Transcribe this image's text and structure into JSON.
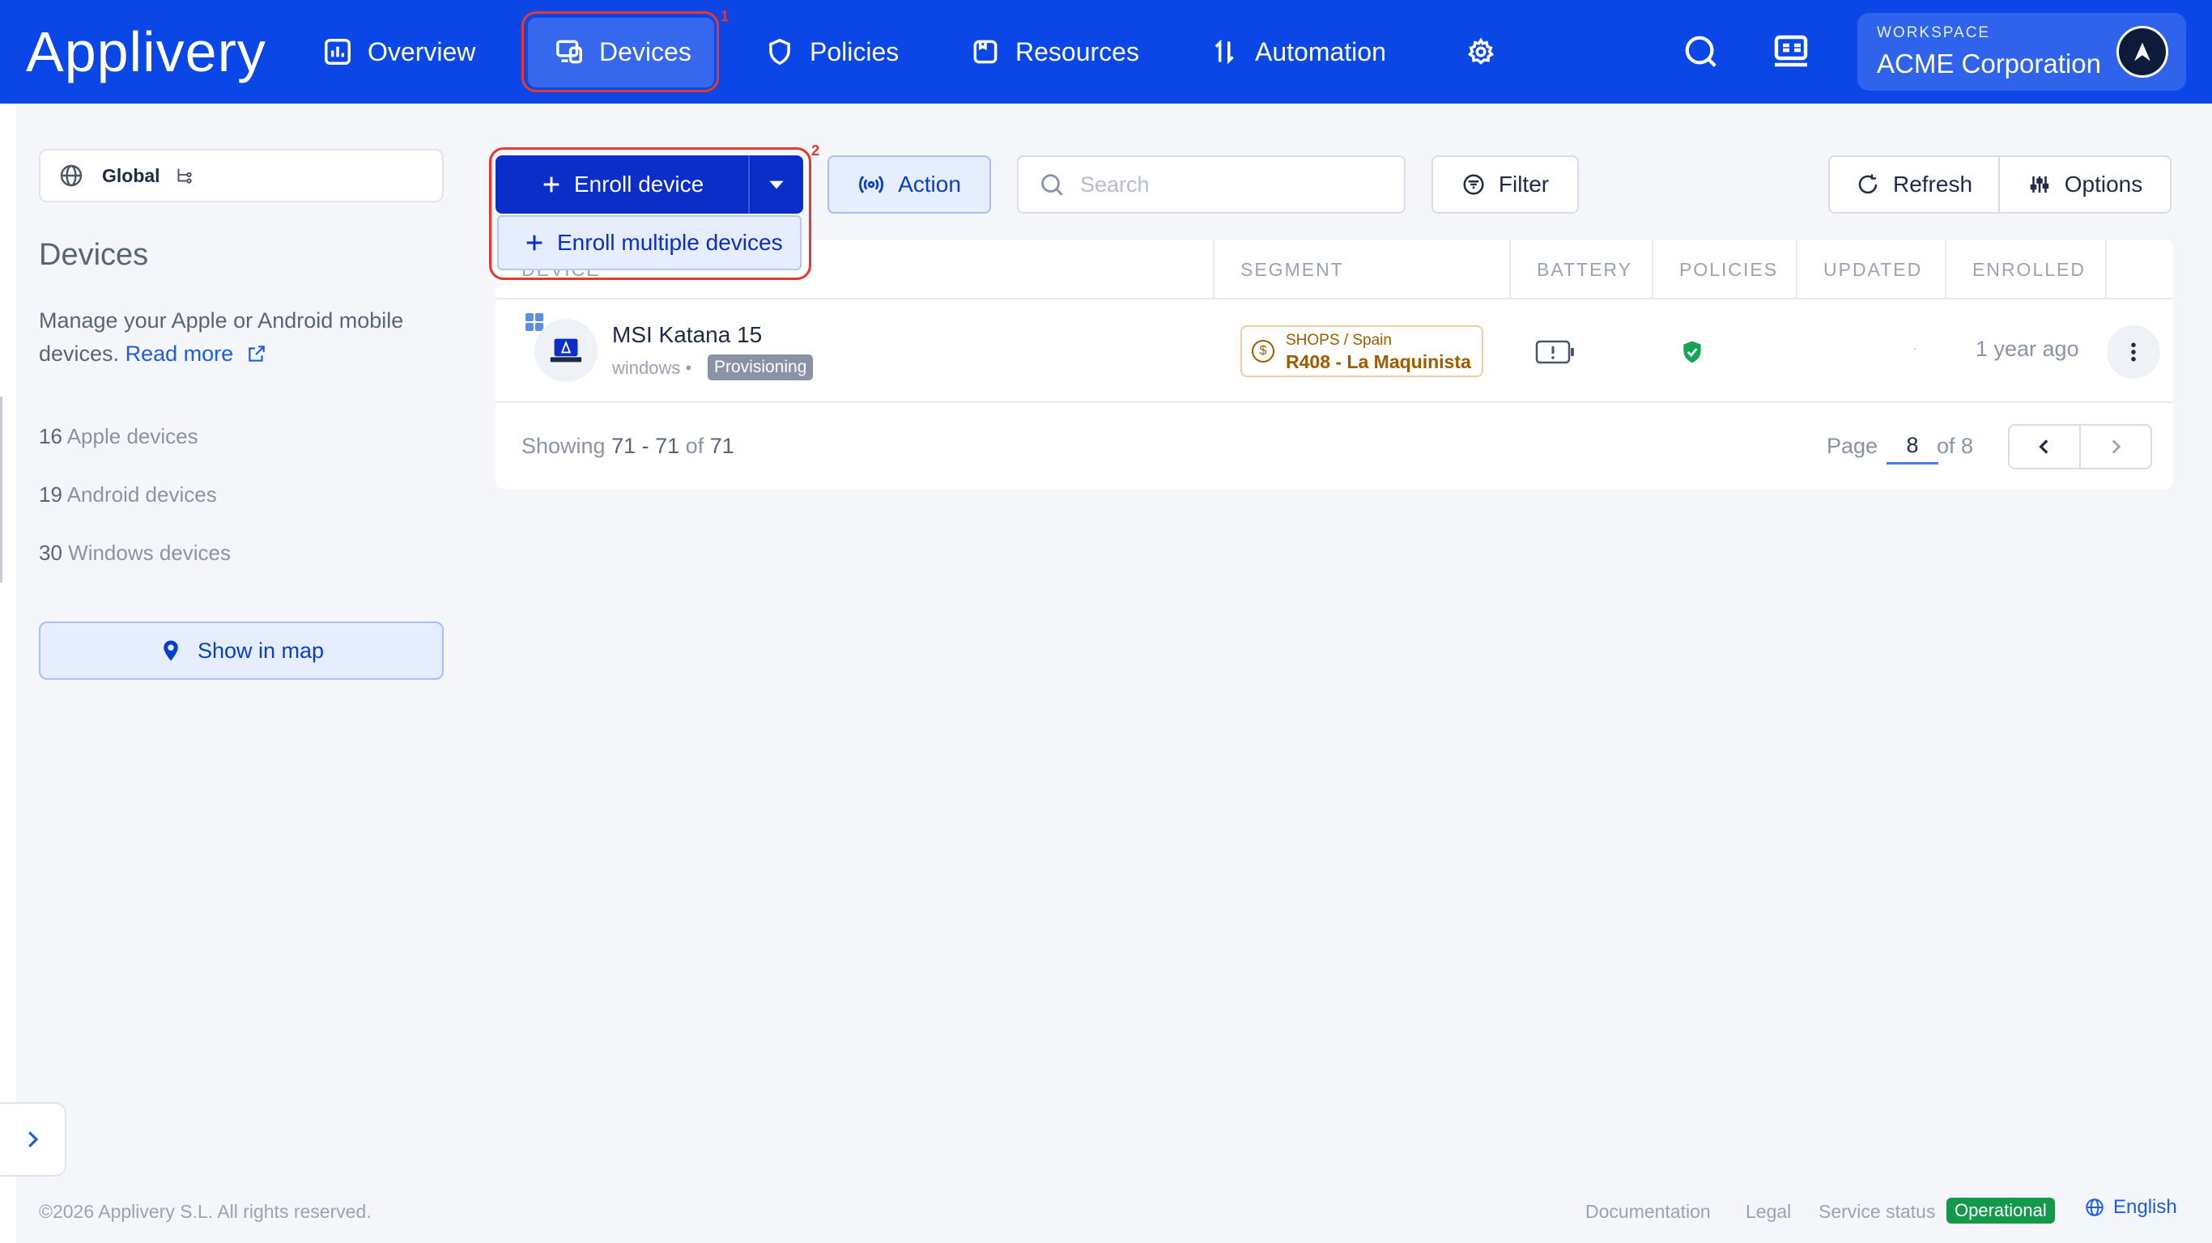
{
  "header": {
    "logo": "Applivery",
    "nav": [
      {
        "label": "Overview"
      },
      {
        "label": "Devices"
      },
      {
        "label": "Policies"
      },
      {
        "label": "Resources"
      },
      {
        "label": "Automation"
      }
    ],
    "highlight_1": "1",
    "workspace_label": "WORKSPACE",
    "workspace_name": "ACME Corporation"
  },
  "sidebar": {
    "scope": "Global",
    "title": "Devices",
    "description": "Manage your Apple or Android mobile devices.",
    "read_more": "Read more",
    "counts": [
      {
        "num": "16",
        "label": "Apple devices"
      },
      {
        "num": "19",
        "label": "Android devices"
      },
      {
        "num": "30",
        "label": "Windows devices"
      }
    ],
    "map_button": "Show in map"
  },
  "toolbar": {
    "enroll_label": "Enroll device",
    "enroll_multiple": "Enroll multiple devices",
    "highlight_2": "2",
    "action_label": "Action",
    "search_placeholder": "Search",
    "filter_label": "Filter",
    "refresh_label": "Refresh",
    "options_label": "Options"
  },
  "table": {
    "columns": {
      "device": "DEVICE",
      "segment": "SEGMENT",
      "battery": "BATTERY",
      "policies": "POLICIES",
      "updated": "UPDATED",
      "enrolled": "ENROLLED"
    },
    "rows": [
      {
        "name": "MSI Katana 15",
        "os": "windows •",
        "status": "Provisioning",
        "segment_path": "SHOPS / Spain",
        "segment_name": "R408 - La Maquinista",
        "updated": "·",
        "enrolled": "1 year ago"
      }
    ],
    "showing_prefix": "Showing",
    "showing_range": "71 - 71",
    "showing_of": "of",
    "showing_total": "71",
    "page_label": "Page",
    "page_current": "8",
    "page_total": "of 8"
  },
  "footer": {
    "copyright": "©2026 Applivery S.L. All rights reserved.",
    "documentation": "Documentation",
    "legal": "Legal",
    "service_status": "Service status",
    "status_value": "Operational",
    "language": "English"
  },
  "colors": {
    "brand": "#0a47e6",
    "primary_button": "#0b2ec9",
    "highlight": "#e5392f",
    "segment": "#a05a00",
    "operational": "#14994b"
  }
}
